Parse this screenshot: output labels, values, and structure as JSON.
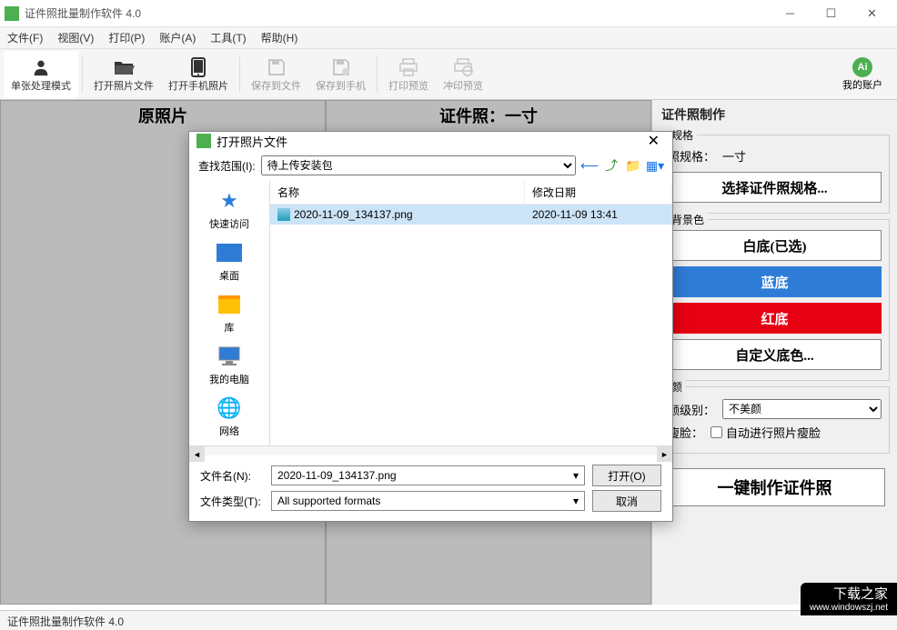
{
  "app": {
    "title": "证件照批量制作软件 4.0"
  },
  "menu": {
    "file": "文件(F)",
    "view": "视图(V)",
    "print": "打印(P)",
    "account": "账户(A)",
    "tools": "工具(T)",
    "help": "帮助(H)"
  },
  "toolbar": {
    "mode": "单张处理模式",
    "open_file": "打开照片文件",
    "open_phone": "打开手机照片",
    "save_file": "保存到文件",
    "save_phone": "保存到手机",
    "print_preview": "打印预览",
    "develop_preview": "冲印预览",
    "my_account": "我的账户"
  },
  "areas": {
    "original": "原照片",
    "idphoto": "证件照：一寸"
  },
  "panel": {
    "title": "证件照制作",
    "spec_group": "规格",
    "spec_label": "照规格：",
    "spec_value": "一寸",
    "spec_btn": "选择证件照规格...",
    "bg_group": "背景色",
    "bg_white": "白底(已选)",
    "bg_blue": "蓝底",
    "bg_red": "红底",
    "bg_custom": "自定义底色...",
    "beauty_group": "颜",
    "beauty_label": "颜级别：",
    "beauty_value": "不美颜",
    "slim_label": "瘦脸：",
    "slim_check": "自动进行照片瘦脸",
    "make_btn": "一键制作证件照"
  },
  "statusbar": {
    "text": "证件照批量制作软件 4.0"
  },
  "watermark": {
    "title": "下载之家",
    "url": "www.windowszj.net"
  },
  "dialog": {
    "title": "打开照片文件",
    "lookin_label": "查找范围(I):",
    "lookin_value": "待上传安装包",
    "side": {
      "quick": "快速访问",
      "desktop": "桌面",
      "library": "库",
      "mypc": "我的电脑",
      "network": "网络"
    },
    "columns": {
      "name": "名称",
      "date": "修改日期"
    },
    "files": [
      {
        "name": "2020-11-09_134137.png",
        "date": "2020-11-09 13:41"
      }
    ],
    "filename_label": "文件名(N):",
    "filename_value": "2020-11-09_134137.png",
    "filetype_label": "文件类型(T):",
    "filetype_value": "All supported formats",
    "open_btn": "打开(O)",
    "cancel_btn": "取消"
  }
}
